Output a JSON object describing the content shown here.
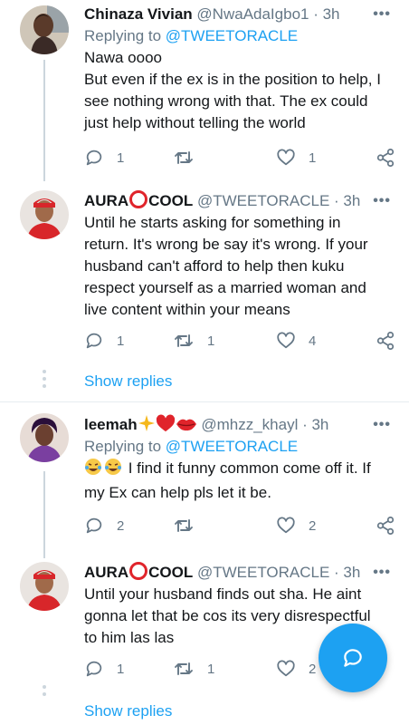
{
  "tweets": [
    {
      "name": "Chinaza Vivian",
      "handle": "@NwaAdaIgbo1 · 3h",
      "replying_prefix": "Replying to ",
      "replying_to": "@TWEETORACLE",
      "lines": [
        "Nawa oooo",
        "But even if the ex is in the position to help, I",
        "see nothing wrong with that. The ex could",
        "just help without telling the world"
      ],
      "replies": "1",
      "retweets": "",
      "likes": "1"
    },
    {
      "name_part1": "AURA",
      "name_part2": "COOL",
      "handle": "@TWEETORACLE · 3h",
      "lines": [
        "Until he starts asking for something in",
        "return. It's wrong be say it's wrong. If your",
        "husband can't afford to help then kuku",
        "respect yourself as a married woman and",
        "live content within your means"
      ],
      "replies": "1",
      "retweets": "1",
      "likes": "4"
    },
    {
      "name": "leemah",
      "handle": "@mhzz_khayl · 3h",
      "replying_prefix": "Replying to ",
      "replying_to": "@TWEETORACLE",
      "line1_text": "I find it funny common come off it. If",
      "line2": "my Ex can help pls let it be.",
      "replies": "2",
      "retweets": "",
      "likes": "2"
    },
    {
      "name_part1": "AURA",
      "name_part2": "COOL",
      "handle": "@TWEETORACLE · 3h",
      "lines": [
        "Until your husband finds out sha. He aint",
        "gonna let that be cos its very disrespectful",
        "to him las las"
      ],
      "replies": "1",
      "retweets": "1",
      "likes": "2"
    }
  ],
  "show_replies": "Show replies",
  "more_glyph": "•••",
  "colors": {
    "accent": "#1da1f2",
    "muted": "#657786",
    "aura_red": "#e0242b"
  }
}
